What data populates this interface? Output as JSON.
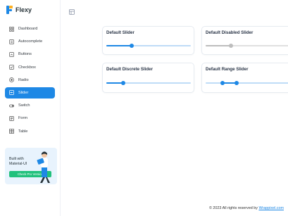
{
  "brand": {
    "name": "Flexy"
  },
  "sidebar": {
    "items": [
      {
        "label": "Dashboard",
        "icon": "grid-icon",
        "active": false
      },
      {
        "label": "Autocomplete",
        "icon": "search-list-icon",
        "active": false
      },
      {
        "label": "Buttons",
        "icon": "button-icon",
        "active": false
      },
      {
        "label": "Checkbox",
        "icon": "checkbox-icon",
        "active": false
      },
      {
        "label": "Radio",
        "icon": "radio-icon",
        "active": false
      },
      {
        "label": "Slider",
        "icon": "slider-icon",
        "active": true
      },
      {
        "label": "Switch",
        "icon": "switch-icon",
        "active": false
      },
      {
        "label": "Form",
        "icon": "form-icon",
        "active": false
      },
      {
        "label": "Table",
        "icon": "table-icon",
        "active": false
      }
    ]
  },
  "promo": {
    "text": "Built with Material-UI",
    "button": "Check Pro Version"
  },
  "cards": [
    {
      "title": "Default Slider",
      "kind": "single",
      "value": 30,
      "disabled": false
    },
    {
      "title": "Default Disabled Slider",
      "kind": "single",
      "value": 30,
      "disabled": true
    },
    {
      "title": "Default Discrete Slider",
      "kind": "discrete",
      "value": 20,
      "disabled": false
    },
    {
      "title": "Default Range Slider",
      "kind": "range",
      "range": [
        20,
        37
      ],
      "disabled": false
    }
  ],
  "footer": {
    "text": "© 2023 All rights reserved by ",
    "link": "Wrappixel.com"
  },
  "colors": {
    "primary": "#1e88e5",
    "success": "#21c17c",
    "disabled": "#bdbdbd"
  }
}
